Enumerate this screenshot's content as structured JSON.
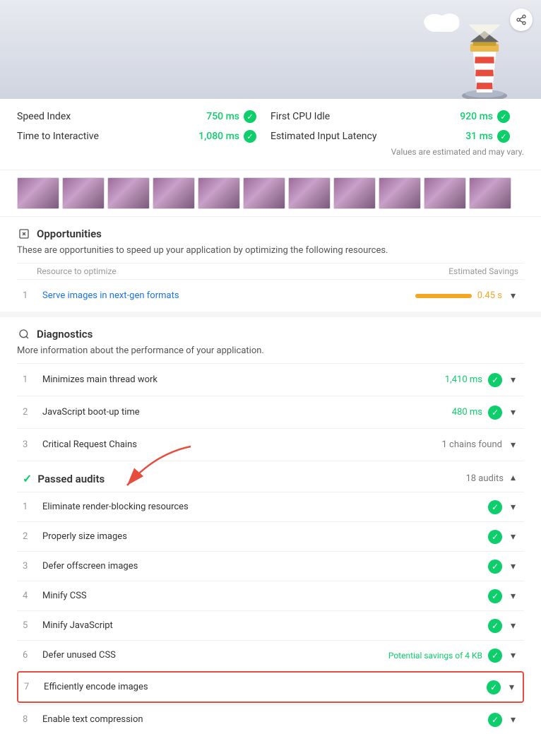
{
  "hero": {
    "share_label": "Share"
  },
  "metrics": {
    "note": "Values are estimated and may vary.",
    "items": [
      {
        "label": "Speed Index",
        "value": "750 ms",
        "status": "pass"
      },
      {
        "label": "First CPU Idle",
        "value": "920 ms",
        "status": "pass"
      },
      {
        "label": "Time to Interactive",
        "value": "1,080 ms",
        "status": "pass"
      },
      {
        "label": "Estimated Input Latency",
        "value": "31 ms",
        "status": "pass"
      }
    ]
  },
  "filmstrip": {
    "frames": [
      1,
      2,
      3,
      4,
      5,
      6,
      7,
      8,
      9,
      10,
      11
    ]
  },
  "opportunities": {
    "section_title": "Opportunities",
    "section_desc": "These are opportunities to speed up your application by optimizing the following resources.",
    "column_resource": "Resource to optimize",
    "column_savings": "Estimated Savings",
    "items": [
      {
        "number": "1",
        "label": "Serve images in next-gen formats",
        "savings": "0.45 s",
        "has_bar": true
      }
    ]
  },
  "diagnostics": {
    "section_title": "Diagnostics",
    "section_desc": "More information about the performance of your application.",
    "items": [
      {
        "number": "1",
        "label": "Minimizes main thread work",
        "value": "1,410 ms",
        "status": "green"
      },
      {
        "number": "2",
        "label": "JavaScript boot-up time",
        "value": "480 ms",
        "status": "green"
      },
      {
        "number": "3",
        "label": "Critical Request Chains",
        "value": "1 chains found",
        "status": "none"
      }
    ]
  },
  "passed_audits": {
    "section_title": "Passed audits",
    "audit_count": "18 audits",
    "items": [
      {
        "number": "1",
        "label": "Eliminate render-blocking resources",
        "savings": "",
        "highlighted": false
      },
      {
        "number": "2",
        "label": "Properly size images",
        "savings": "",
        "highlighted": false
      },
      {
        "number": "3",
        "label": "Defer offscreen images",
        "savings": "",
        "highlighted": false
      },
      {
        "number": "4",
        "label": "Minify CSS",
        "savings": "",
        "highlighted": false
      },
      {
        "number": "5",
        "label": "Minify JavaScript",
        "savings": "",
        "highlighted": false
      },
      {
        "number": "6",
        "label": "Defer unused CSS",
        "savings": "Potential savings of 4 KB",
        "highlighted": false
      },
      {
        "number": "7",
        "label": "Efficiently encode images",
        "savings": "",
        "highlighted": true
      },
      {
        "number": "8",
        "label": "Enable text compression",
        "savings": "",
        "highlighted": false
      }
    ]
  }
}
